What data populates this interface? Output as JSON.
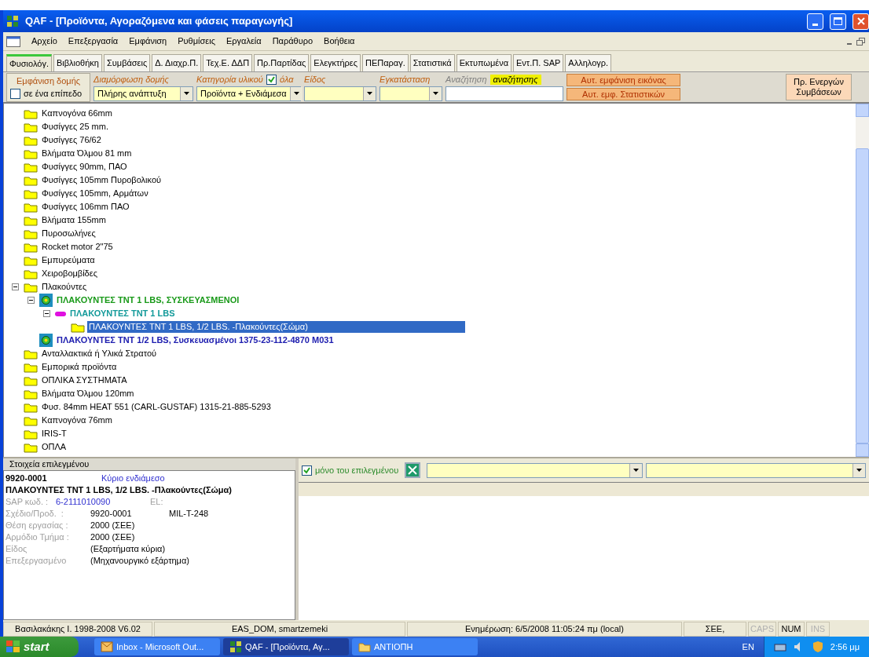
{
  "window": {
    "title": "QAF - [Προϊόντα, Αγοραζόμενα και φάσεις παραγωγής]"
  },
  "menu": [
    "Αρχείο",
    "Επεξεργασία",
    "Εμφάνιση",
    "Ρυθμίσεις",
    "Εργαλεία",
    "Παράθυρο",
    "Βοήθεια"
  ],
  "tabs": [
    {
      "label": "Φυσιολόγ.",
      "selected": true
    },
    {
      "label": "Βιβλιοθήκη",
      "selected": false
    },
    {
      "label": "Συμβάσεις",
      "selected": false
    },
    {
      "label": "Δ. Διαχρ.Π.",
      "selected": false
    },
    {
      "label": "Τεχ.Ε. ΔΔΠ",
      "selected": false
    },
    {
      "label": "Πρ.Παρτίδας",
      "selected": false
    },
    {
      "label": "Ελεγκτήρες",
      "selected": false
    },
    {
      "label": "ΠΕΠαραγ.",
      "selected": false
    },
    {
      "label": "Στατιστικά",
      "selected": false
    },
    {
      "label": "Εκτυπωμένα",
      "selected": false
    },
    {
      "label": "Εντ.Π. SAP",
      "selected": false
    },
    {
      "label": "Αλληλογρ.",
      "selected": false
    }
  ],
  "filters": {
    "structure_button": "Εμφάνιση δομής",
    "one_level": {
      "label": "σε ένα επίπεδο",
      "checked": false
    },
    "layout": {
      "label": "Διαμόρφωση δομής",
      "value": "Πλήρης ανάπτυξη"
    },
    "category": {
      "label": "Κατηγορία υλικού",
      "all": {
        "label": "όλα",
        "checked": true
      },
      "value": "Προϊόντα + Ενδιάμεσα"
    },
    "type": {
      "label": "Είδος"
    },
    "plant": {
      "label": "Εγκατάσταση"
    },
    "search": {
      "label": "Αναζήτηση",
      "button": "αναζήτησης"
    },
    "auto_buttons": [
      "Αυτ. εμφάνιση εικόνας",
      "Αυτ. εμφ. Στατιστικών"
    ],
    "contracts_button": [
      "Πρ. Ενεργών",
      "Συμβάσεων"
    ]
  },
  "tree": [
    {
      "kind": "folder",
      "label": "Καπνογόνα 66mm",
      "selected": false
    },
    {
      "kind": "folder",
      "label": "Φυσίγγες 25 mm.",
      "selected": false
    },
    {
      "kind": "folder",
      "label": "Φυσίγγες 76/62",
      "selected": false
    },
    {
      "kind": "folder",
      "label": "Βλήματα Όλμου 81 mm",
      "selected": false
    },
    {
      "kind": "folder",
      "label": "Φυσίγγες 90mm, ΠΑΟ",
      "selected": false
    },
    {
      "kind": "folder",
      "label": "Φυσίγγες 105mm Πυροβολικού",
      "selected": false
    },
    {
      "kind": "folder",
      "label": "Φυσίγγες 105mm, Αρμάτων",
      "selected": false
    },
    {
      "kind": "folder",
      "label": "Φυσίγγες 106mm ΠΑΟ",
      "selected": false
    },
    {
      "kind": "folder",
      "label": "Βλήματα 155mm",
      "selected": false
    },
    {
      "kind": "folder",
      "label": "Πυροσωλήνες",
      "selected": false
    },
    {
      "kind": "folder",
      "label": "Rocket motor 2\"75",
      "selected": false
    },
    {
      "kind": "folder",
      "label": "Εμπυρεύματα",
      "selected": false
    },
    {
      "kind": "folder",
      "label": "Χειροβομβίδες",
      "selected": false
    },
    {
      "kind": "folder",
      "label": "Πλακούντες",
      "selected": false,
      "expanded": true,
      "children": [
        {
          "kind": "package",
          "label": "ΠΛΑΚΟΥΝΤΕΣ TNT 1 LBS, ΣΥΣΚΕΥΑΣΜΕΝΟΙ",
          "color": "#1a9a1a",
          "selected": false,
          "expanded": true,
          "children": [
            {
              "kind": "intermediate",
              "label": "ΠΛΑΚΟΥΝΤΕΣ TNT 1 LBS",
              "color": "#139a9a",
              "selected": false,
              "expanded": true,
              "children": [
                {
                  "kind": "folder",
                  "label": "ΠΛΑΚΟΥΝΤΕΣ TNT 1 LBS, 1/2 LBS. -Πλακούντες(Σώμα)",
                  "selected": true
                }
              ]
            }
          ]
        },
        {
          "kind": "package",
          "label": "ΠΛΑΚΟΥΝΤΕΣ TNT 1/2 LBS, Συσκευασμένοι 1375-23-112-4870 M031",
          "color": "#2020b0",
          "selected": false
        }
      ]
    },
    {
      "kind": "folder",
      "label": "Ανταλλακτικά ή Υλικά Στρατού",
      "selected": false
    },
    {
      "kind": "folder",
      "label": "Εμπορικά προϊόντα",
      "selected": false
    },
    {
      "kind": "folder",
      "label": "ΟΠΛΙΚΑ ΣΥΣΤΗΜΑΤΑ",
      "selected": false
    },
    {
      "kind": "folder",
      "label": "Βλήματα Όλμου 120mm",
      "selected": false
    },
    {
      "kind": "folder",
      "label": "Φυσ. 84mm HEAT 551 (CARL-GUSTAF) 1315-21-885-5293",
      "selected": false
    },
    {
      "kind": "folder",
      "label": "Καπνογόνα 76mm",
      "selected": false
    },
    {
      "kind": "folder",
      "label": "IRIS-T",
      "selected": false
    },
    {
      "kind": "folder",
      "label": "ΟΠΛΑ",
      "selected": false
    }
  ],
  "details": {
    "title": "Στοιχεία επιλεγμένου",
    "code": "9920-0001",
    "role": "Κύριο ενδιάμεσο",
    "name": "ΠΛΑΚΟΥΝΤΕΣ TNT 1 LBS, 1/2 LBS. -Πλακούντες(Σώμα)",
    "sap_label": "SAP κωδ. :",
    "sap_code": "6-2111010090",
    "el_label": "EL:",
    "fields": [
      {
        "label": "Σχέδιο/Προδ.  :",
        "value": "9920-0001",
        "extra": "MIL-T-248"
      },
      {
        "label": "Θέση εργασίας :",
        "value": "2000 (ΣΕΕ)"
      },
      {
        "label": "Αρμόδιο Τμήμα :",
        "value": "2000 (ΣΕΕ)"
      },
      {
        "label": "Είδος",
        "value": "(Εξαρτήματα κύρια)"
      },
      {
        "label": "Επεξεργασμένο",
        "value": "(Μηχανουργικό εξάρτημα)"
      }
    ]
  },
  "related": {
    "only_selected": {
      "label": "μόνο του επιλεγμένου",
      "checked": true
    }
  },
  "status_bar": [
    {
      "text": "Βασιλακάκης Ι. 1998-2008 V6.02",
      "enabled": true
    },
    {
      "text": "EAS_DOM, smartzemeki",
      "enabled": true
    },
    {
      "text": "Ενημέρωση: 6/5/2008 11:05:24 πμ (local)",
      "enabled": true
    },
    {
      "text": "ΣΕΕ,",
      "enabled": true
    },
    {
      "text": "CAPS",
      "enabled": false
    },
    {
      "text": "NUM",
      "enabled": true
    },
    {
      "text": "INS",
      "enabled": false
    }
  ],
  "taskbar": {
    "start": "start",
    "tasks": [
      {
        "label": "Inbox - Microsoft Out...",
        "kind": "mail",
        "selected": false
      },
      {
        "label": "QAF - [Προϊόντα, Αγ...",
        "kind": "app",
        "selected": true
      },
      {
        "label": "ΑΝΤΙΟΠΗ",
        "kind": "folder",
        "selected": false
      }
    ],
    "language": "EN",
    "clock": "2:56 μμ"
  }
}
